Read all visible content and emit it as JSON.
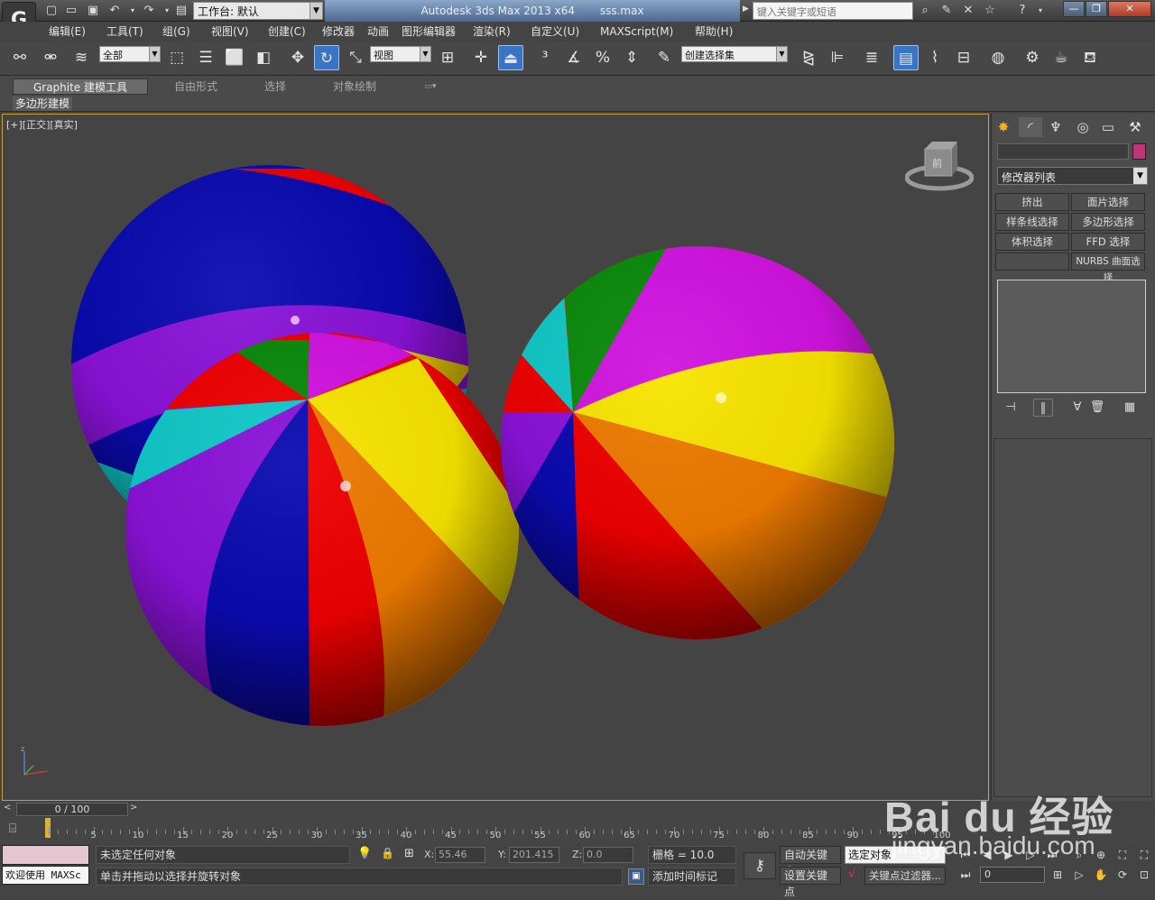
{
  "titlebar": {
    "workspace": "工作台: 默认",
    "app_title": "Autodesk 3ds Max  2013 x64",
    "file_name": "sss.max",
    "search_placeholder": "键入关键字或短语"
  },
  "menu": [
    "编辑(E)",
    "工具(T)",
    "组(G)",
    "视图(V)",
    "创建(C)",
    "修改器",
    "动画",
    "图形编辑器",
    "渲染(R)",
    "自定义(U)",
    "MAXScript(M)",
    "帮助(H)"
  ],
  "toolbar": {
    "selection_filter": "全部",
    "ref_coord": "视图",
    "named_selection": "创建选择集"
  },
  "ribbon": {
    "tabs": [
      "Graphite 建模工具",
      "自由形式",
      "选择",
      "对象绘制"
    ],
    "subtab": "多边形建模"
  },
  "viewport": {
    "label": "[+][正交][真实]",
    "viewcube_face": "前"
  },
  "command_panel": {
    "modifier_list": "修改器列表",
    "modifier_color": "#c0357a",
    "buttons": [
      "挤出",
      "面片选择",
      "样条线选择",
      "多边形选择",
      "体积选择",
      "FFD 选择",
      "",
      "NURBS 曲面选择"
    ]
  },
  "timeline": {
    "slider": "0 / 100",
    "ticks": [
      "0",
      "5",
      "10",
      "15",
      "20",
      "25",
      "30",
      "35",
      "40",
      "45",
      "50",
      "55",
      "60",
      "65",
      "70",
      "75",
      "80",
      "85",
      "90",
      "95",
      "100"
    ]
  },
  "status": {
    "maxscript_welcome": "欢迎使用 MAXSc",
    "selection_status": "未选定任何对象",
    "prompt": "单击并拖动以选择并旋转对象",
    "x_label": "X:",
    "x_value": "55.46",
    "y_label": "Y:",
    "y_value": "201.415",
    "z_label": "Z:",
    "z_value": "0.0",
    "grid": "栅格 = 10.0",
    "add_time_tag": "添加时间标记",
    "auto_key": "自动关键点",
    "set_key": "设置关键点",
    "selected": "选定对象",
    "key_filters": "关键点过滤器...",
    "frame": "0"
  },
  "watermark": {
    "brand": "Bai du 经验",
    "url": "jingyan.baidu.com"
  }
}
